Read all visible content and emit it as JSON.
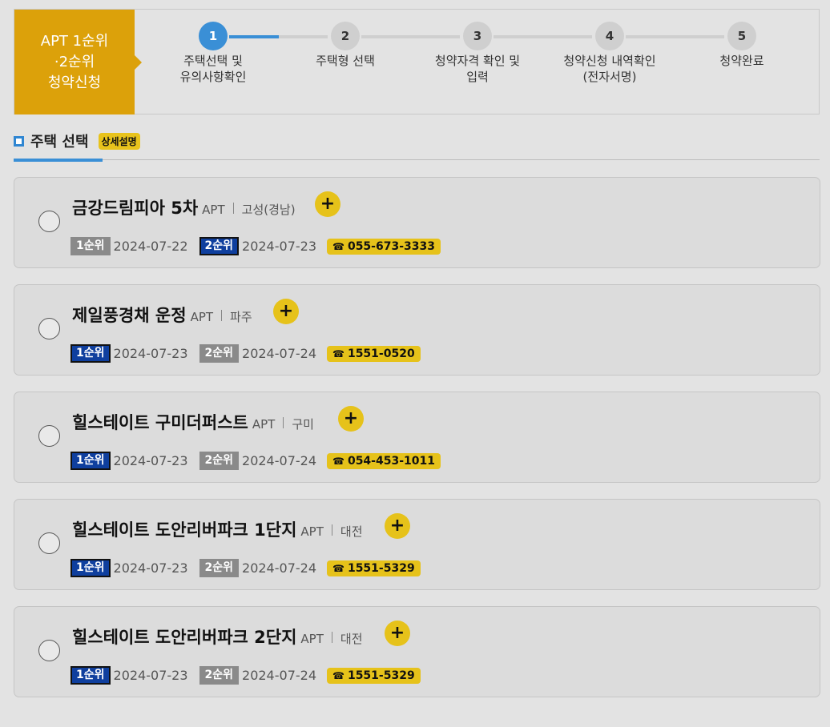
{
  "header": {
    "badge_lines": [
      "APT 1순위",
      "·2순위",
      "청약신청"
    ],
    "steps": [
      {
        "num": "1",
        "lines": [
          "주택선택 및",
          "유의사항확인"
        ]
      },
      {
        "num": "2",
        "lines": [
          "주택형 선택"
        ]
      },
      {
        "num": "3",
        "lines": [
          "청약자격 확인 및",
          "입력"
        ]
      },
      {
        "num": "4",
        "lines": [
          "청약신청 내역확인",
          "(전자서명)"
        ]
      },
      {
        "num": "5",
        "lines": [
          "청약완료"
        ]
      }
    ],
    "current_step": 1,
    "current_progress": 0.5
  },
  "section": {
    "title": "주택 선택",
    "detail_button": "상세설명"
  },
  "listings": [
    {
      "name": "금강드림피아 5차",
      "type": "APT",
      "region": "고성(경남)",
      "plus": "+",
      "rank1_label": "1순위",
      "rank1_date": "2024-07-22",
      "rank2_label": "2순위",
      "rank2_date": "2024-07-23",
      "active_rank": 2,
      "phone": "055-673-3333"
    },
    {
      "name": "제일풍경채 운정",
      "type": "APT",
      "region": "파주",
      "plus": "+",
      "rank1_label": "1순위",
      "rank1_date": "2024-07-23",
      "rank2_label": "2순위",
      "rank2_date": "2024-07-24",
      "active_rank": 1,
      "phone": "1551-0520"
    },
    {
      "name": "힐스테이트 구미더퍼스트",
      "type": "APT",
      "region": "구미",
      "plus": "+",
      "rank1_label": "1순위",
      "rank1_date": "2024-07-23",
      "rank2_label": "2순위",
      "rank2_date": "2024-07-24",
      "active_rank": 1,
      "phone": "054-453-1011"
    },
    {
      "name": "힐스테이트 도안리버파크 1단지",
      "type": "APT",
      "region": "대전",
      "plus": "+",
      "rank1_label": "1순위",
      "rank1_date": "2024-07-23",
      "rank2_label": "2순위",
      "rank2_date": "2024-07-24",
      "active_rank": 1,
      "phone": "1551-5329"
    },
    {
      "name": "힐스테이트 도안리버파크 2단지",
      "type": "APT",
      "region": "대전",
      "plus": "+",
      "rank1_label": "1순위",
      "rank1_date": "2024-07-23",
      "rank2_label": "2순위",
      "rank2_date": "2024-07-24",
      "active_rank": 1,
      "phone": "1551-5329"
    }
  ],
  "icons": {
    "phone": "☎"
  },
  "colors": {
    "accent_blue": "#3a8fd6",
    "badge_gold": "#dca10a",
    "tag_yellow": "#e6c21a",
    "rank_active": "#0f3f9e",
    "rank_inactive": "#8a8a8a"
  }
}
